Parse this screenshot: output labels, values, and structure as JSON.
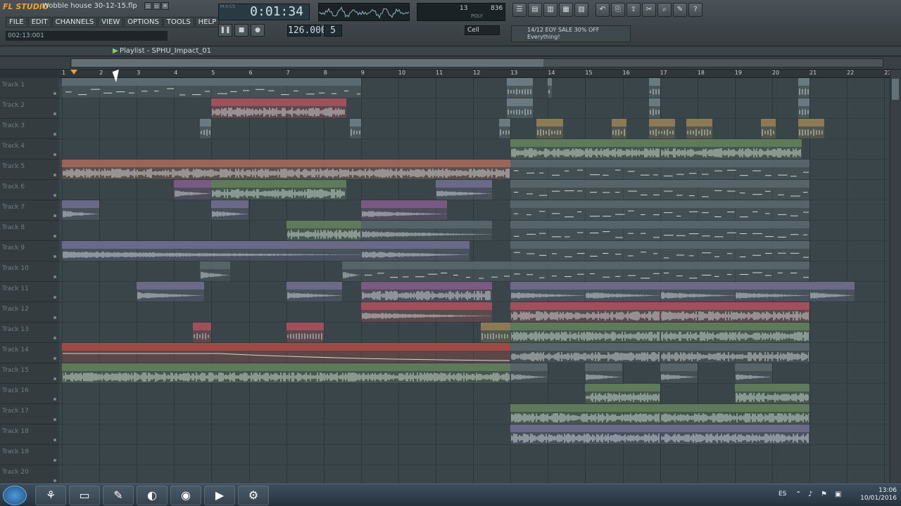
{
  "window": {
    "logo": "FL STUDIO",
    "song_title": "Wobble house 30-12-15.flp",
    "min": "▫",
    "restore": "▫",
    "close": "✕"
  },
  "menu": [
    "FILE",
    "EDIT",
    "CHANNELS",
    "VIEW",
    "OPTIONS",
    "TOOLS",
    "HELP"
  ],
  "time_info": "002:13:001",
  "lcd": {
    "time": "0:01:34",
    "hint": "M:S:CS"
  },
  "transport": {
    "pattern_label": "PAT",
    "song_label": "SONG",
    "tempo": "126.000",
    "tempo_label": "TEMPO",
    "pattern_number": "5",
    "pattern_label2": "PAT"
  },
  "cpu": {
    "cpu": "13",
    "mem": "836",
    "poly_label": "POLY",
    "cpu_label": "CPU",
    "mem_label": "MB"
  },
  "snap": "Cell",
  "news": {
    "line1": "14/12  EOY SALE 30% OFF",
    "line2": "Everything!"
  },
  "playlist": {
    "title": "Playlist - SPHU_Impact_01",
    "ruler_label": "BAR"
  },
  "bars": [
    "1",
    "2",
    "3",
    "4",
    "5",
    "6",
    "7",
    "8",
    "9",
    "10",
    "11",
    "12",
    "13",
    "14",
    "15",
    "16",
    "17",
    "18",
    "19",
    "20",
    "21",
    "22",
    "23"
  ],
  "tracks": [
    "Track 1",
    "Track 2",
    "Track 3",
    "Track 4",
    "Track 5",
    "Track 6",
    "Track 7",
    "Track 8",
    "Track 9",
    "Track 10",
    "Track 11",
    "Track 12",
    "Track 13",
    "Track 14",
    "Track 15",
    "Track 16",
    "Track 17",
    "Track 18",
    "Track 19",
    "Track 20"
  ],
  "clips": [
    {
      "t": 0,
      "s": 1,
      "e": 9,
      "n": "Pattern 1",
      "c": "#5b6a70",
      "w": "dash"
    },
    {
      "t": 0,
      "s": 12.9,
      "e": 13.6,
      "n": "SP..25",
      "c": "#6b7a80",
      "w": "dot"
    },
    {
      "t": 0,
      "s": 14,
      "e": 14.1,
      "n": "",
      "c": "#6b7a80",
      "w": "dot"
    },
    {
      "t": 0,
      "s": 16.7,
      "e": 17,
      "n": "",
      "c": "#6b7a80",
      "w": "dot"
    },
    {
      "t": 0,
      "s": 20.7,
      "e": 21,
      "n": "",
      "c": "#6b7a80",
      "w": "dot"
    },
    {
      "t": 1,
      "s": 5,
      "e": 8.6,
      "n": "SPHU_Top_Drum_Loop_10_126_BPM",
      "c": "#a0505a",
      "w": "dense"
    },
    {
      "t": 1,
      "s": 12.9,
      "e": 13.6,
      "n": "SP..M",
      "c": "#6b7a80",
      "w": "dot"
    },
    {
      "t": 1,
      "s": 16.7,
      "e": 17,
      "n": "",
      "c": "#6b7a80",
      "w": "dot"
    },
    {
      "t": 1,
      "s": 20.7,
      "e": 21,
      "n": "",
      "c": "#6b7a80",
      "w": "dot"
    },
    {
      "t": 2,
      "s": 4.7,
      "e": 5,
      "n": "",
      "c": "#6b7a80",
      "w": "dot"
    },
    {
      "t": 2,
      "s": 8.7,
      "e": 9,
      "n": "",
      "c": "#6b7a80",
      "w": "dot"
    },
    {
      "t": 2,
      "s": 12.7,
      "e": 13,
      "n": "",
      "c": "#6b7a80",
      "w": "dot"
    },
    {
      "t": 2,
      "s": 13.7,
      "e": 14.4,
      "n": "SP..M",
      "c": "#8a7a55",
      "w": "dot"
    },
    {
      "t": 2,
      "s": 15.7,
      "e": 16.1,
      "n": "",
      "c": "#8a7a55",
      "w": "dot"
    },
    {
      "t": 2,
      "s": 16.7,
      "e": 17.4,
      "n": "SP..PM",
      "c": "#8a7a55",
      "w": "dot"
    },
    {
      "t": 2,
      "s": 17.7,
      "e": 18.4,
      "n": "SP..M",
      "c": "#8a7a55",
      "w": "dot"
    },
    {
      "t": 2,
      "s": 19.7,
      "e": 20.1,
      "n": "",
      "c": "#8a7a55",
      "w": "dot"
    },
    {
      "t": 2,
      "s": 20.7,
      "e": 21.4,
      "n": "SP..PM",
      "c": "#8a7a55",
      "w": "dot"
    },
    {
      "t": 3,
      "s": 13,
      "e": 17,
      "n": "Kick_004",
      "c": "#5f7a5a",
      "w": "dense"
    },
    {
      "t": 3,
      "s": 17,
      "e": 20.8,
      "n": "Kick_004",
      "c": "#5f7a5a",
      "w": "dense"
    },
    {
      "t": 4,
      "s": 1,
      "e": 13,
      "n": "Piano_Loop_11_A_126_BPM",
      "c": "#9a6458",
      "w": "dense"
    },
    {
      "t": 4,
      "s": 13,
      "e": 17,
      "n": "WOB _BASS 1\\4",
      "c": "#56646a",
      "w": "dash"
    },
    {
      "t": 4,
      "s": 17,
      "e": 21,
      "n": "WOB _BASS 1\\4",
      "c": "#56646a",
      "w": "dash"
    },
    {
      "t": 5,
      "s": 4,
      "e": 5,
      "n": "SPHU_..ever",
      "c": "#7a5a82",
      "w": "fade"
    },
    {
      "t": 5,
      "s": 5,
      "e": 8.6,
      "n": "SPHU_Clap_02",
      "c": "#5f7a5a",
      "w": "dense"
    },
    {
      "t": 5,
      "s": 11,
      "e": 12.5,
      "n": "SPHU_Sw..p_Up_03",
      "c": "#6a6a88",
      "w": "fade"
    },
    {
      "t": 5,
      "s": 13,
      "e": 17,
      "n": "SUB 1\\4",
      "c": "#56646a",
      "w": "dash"
    },
    {
      "t": 5,
      "s": 17,
      "e": 21,
      "n": "SUB 1\\4",
      "c": "#56646a",
      "w": "dash"
    },
    {
      "t": 6,
      "s": 1,
      "e": 2,
      "n": "SPHU..h_06",
      "c": "#6a6a88",
      "w": "fade"
    },
    {
      "t": 6,
      "s": 5,
      "e": 6,
      "n": "SPHU..h_06",
      "c": "#6a6a88",
      "w": "fade"
    },
    {
      "t": 6,
      "s": 9,
      "e": 11.3,
      "n": "SPHU_Sweep_Down_10",
      "c": "#7a5a82",
      "w": "fade"
    },
    {
      "t": 6,
      "s": 13,
      "e": 17,
      "n": "WOB _BASS 1\\16",
      "c": "#56646a",
      "w": "dash"
    },
    {
      "t": 6,
      "s": 17,
      "e": 21,
      "n": "WOB _BASS 1\\16",
      "c": "#56646a",
      "w": "dash"
    },
    {
      "t": 7,
      "s": 7,
      "e": 9,
      "n": "SPHU_Noise_Fx_08",
      "c": "#5f7a5a",
      "w": "dense"
    },
    {
      "t": 7,
      "s": 9,
      "e": 12.5,
      "n": "SPHU_Sweep_Up_15",
      "c": "#56646a",
      "w": "fade"
    },
    {
      "t": 7,
      "s": 13,
      "e": 17,
      "n": "SUB 1\\16",
      "c": "#56646a",
      "w": "dash"
    },
    {
      "t": 7,
      "s": 17,
      "e": 21,
      "n": "SUB 1\\16",
      "c": "#56646a",
      "w": "dash"
    },
    {
      "t": 8,
      "s": 1,
      "e": 9,
      "n": "SPHU_Sweep_Down_06",
      "c": "#6a6a88",
      "w": "fade"
    },
    {
      "t": 8,
      "s": 9,
      "e": 11.9,
      "n": "SPHU_Sweep_Up_19",
      "c": "#6a6a88",
      "w": "fade"
    },
    {
      "t": 8,
      "s": 13,
      "e": 17,
      "n": "WOB _BASS 1\\8",
      "c": "#56646a",
      "w": "dash"
    },
    {
      "t": 8,
      "s": 17,
      "e": 21,
      "n": "WOB _BASS 1\\8",
      "c": "#56646a",
      "w": "dash"
    },
    {
      "t": 9,
      "s": 4.7,
      "e": 5.5,
      "n": "SPH..20",
      "c": "#56646a",
      "w": "fade"
    },
    {
      "t": 9,
      "s": 8.5,
      "e": 9,
      "n": "SPH..",
      "c": "#56646a",
      "w": "fade"
    },
    {
      "t": 9,
      "s": 9,
      "e": 13,
      "n": "Pattern 2",
      "c": "#56646a",
      "w": "dash"
    },
    {
      "t": 9,
      "s": 13,
      "e": 17,
      "n": "SUB 1\\8",
      "c": "#56646a",
      "w": "dash"
    },
    {
      "t": 9,
      "s": 17,
      "e": 21,
      "n": "SUB 1\\8",
      "c": "#56646a",
      "w": "dash"
    },
    {
      "t": 10,
      "s": 3,
      "e": 4.8,
      "n": "SPHU_Sweep_Up_03",
      "c": "#6a6a88",
      "w": "fade"
    },
    {
      "t": 10,
      "s": 7,
      "e": 8.5,
      "n": "SPHU_Sw..p_Up_03",
      "c": "#6a6a88",
      "w": "fade"
    },
    {
      "t": 10,
      "s": 9,
      "e": 12.5,
      "n": "SPHU_Snare_14",
      "c": "#7a5a82",
      "w": "dense"
    },
    {
      "t": 10,
      "s": 13,
      "e": 15,
      "n": "SPHU_I..act_01",
      "c": "#6a6a88",
      "w": "fade"
    },
    {
      "t": 10,
      "s": 15,
      "e": 17,
      "n": "SPHU_I..act_01",
      "c": "#6a6a88",
      "w": "fade"
    },
    {
      "t": 10,
      "s": 17,
      "e": 19,
      "n": "SPHU_t_01_01",
      "c": "#6a6a88",
      "w": "fade"
    },
    {
      "t": 10,
      "s": 19,
      "e": 21,
      "n": "SPHU_I..act_01",
      "c": "#6a6a88",
      "w": "fade"
    },
    {
      "t": 10,
      "s": 21,
      "e": 22.2,
      "n": "SPHU_I..act_01",
      "c": "#6a6a88",
      "w": "fade"
    },
    {
      "t": 11,
      "s": 9,
      "e": 12.5,
      "n": "SPHU_Snare_2_pitched",
      "c": "#a0505a",
      "w": "fade"
    },
    {
      "t": 11,
      "s": 13,
      "e": 17,
      "n": "SPHU_Top_Drum_Loop_38_126_BPM",
      "c": "#a0505a",
      "w": "dense"
    },
    {
      "t": 11,
      "s": 17,
      "e": 21,
      "n": "SPHU_Top_Drum_Loop_38_126_BPM",
      "c": "#a0505a",
      "w": "dense"
    },
    {
      "t": 12,
      "s": 4.5,
      "e": 5,
      "n": "S..M",
      "c": "#a0505a",
      "w": "dot"
    },
    {
      "t": 12,
      "s": 7,
      "e": 8,
      "n": "SPHU..BPM",
      "c": "#a0505a",
      "w": "dot"
    },
    {
      "t": 12,
      "s": 12.2,
      "e": 13,
      "n": "SPH..PM",
      "c": "#8a7a55",
      "w": "dot"
    },
    {
      "t": 12,
      "s": 13,
      "e": 17,
      "n": "Clap_13",
      "c": "#5f7a5a",
      "w": "dense"
    },
    {
      "t": 12,
      "s": 17,
      "e": 21,
      "n": "Clap_13",
      "c": "#5f7a5a",
      "w": "dense"
    },
    {
      "t": 13,
      "s": 1,
      "e": 13,
      "n": "Fruity Filter (SPHU_Piano_Loop_11_A_126_BPM) - Cutoff freq envelope",
      "c": "#a04a48",
      "w": "env"
    },
    {
      "t": 13,
      "s": 13,
      "e": 17,
      "n": "Open_HiHat_12",
      "c": "#56646a",
      "w": "dense"
    },
    {
      "t": 13,
      "s": 17,
      "e": 21,
      "n": "Open_HiHat_12",
      "c": "#56646a",
      "w": "dense"
    },
    {
      "t": 14,
      "s": 1,
      "e": 13,
      "n": "Vox_Loop_10_A_126_BPM",
      "c": "#5f7a5a",
      "w": "dense"
    },
    {
      "t": 14,
      "s": 13,
      "e": 14,
      "n": "SPH..h_07",
      "c": "#56646a",
      "w": "fade"
    },
    {
      "t": 14,
      "s": 15,
      "e": 16,
      "n": "SPH..h_07",
      "c": "#56646a",
      "w": "fade"
    },
    {
      "t": 14,
      "s": 17,
      "e": 18,
      "n": "SPH..h_07",
      "c": "#56646a",
      "w": "fade"
    },
    {
      "t": 14,
      "s": 19,
      "e": 20,
      "n": "SPH..h_07",
      "c": "#56646a",
      "w": "fade"
    },
    {
      "t": 15,
      "s": 15,
      "e": 17,
      "n": "SPHU_Noise_Fx_09",
      "c": "#5f7a5a",
      "w": "dense"
    },
    {
      "t": 15,
      "s": 19,
      "e": 21,
      "n": "SPHU_Noise_Fx_09",
      "c": "#5f7a5a",
      "w": "dense"
    },
    {
      "t": 16,
      "s": 13,
      "e": 17,
      "n": "Noise_Fx_02",
      "c": "#5f7a5a",
      "w": "dense"
    },
    {
      "t": 16,
      "s": 17,
      "e": 21,
      "n": "Noise_Fx_02",
      "c": "#5f7a5a",
      "w": "dense"
    },
    {
      "t": 17,
      "s": 13,
      "e": 17,
      "n": "BassLine",
      "c": "#6a6a88",
      "w": "dense"
    },
    {
      "t": 17,
      "s": 17,
      "e": 21,
      "n": "BassLine",
      "c": "#6a6a88",
      "w": "dense"
    }
  ],
  "taskbar": {
    "lang": "ES",
    "time": "13:06",
    "date": "10/01/2016"
  }
}
